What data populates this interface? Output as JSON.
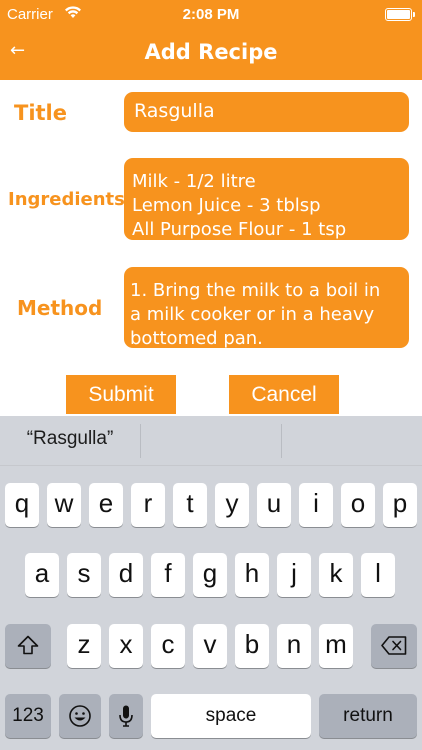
{
  "status_bar": {
    "carrier": "Carrier",
    "time": "2:08 PM"
  },
  "nav": {
    "back_icon": "←",
    "title": "Add Recipe"
  },
  "form": {
    "title_label": "Title",
    "title_value": "Rasgulla",
    "ingredients_label": "Ingredients",
    "ingredients_lines": [
      "Milk - 1/2 litre",
      "Lemon Juice - 3 tblsp",
      "All Purpose Flour - 1 tsp"
    ],
    "method_label": "Method",
    "method_lines": [
      "1. Bring the milk to a boil in",
      "a milk cooker or in a heavy",
      "bottomed pan."
    ]
  },
  "buttons": {
    "submit": "Submit",
    "cancel": "Cancel"
  },
  "keyboard": {
    "suggestions": [
      "“Rasgulla”",
      "",
      ""
    ],
    "row1": [
      "q",
      "w",
      "e",
      "r",
      "t",
      "y",
      "u",
      "i",
      "o",
      "p"
    ],
    "row2": [
      "a",
      "s",
      "d",
      "f",
      "g",
      "h",
      "j",
      "k",
      "l"
    ],
    "row3": [
      "z",
      "x",
      "c",
      "v",
      "b",
      "n",
      "m"
    ],
    "numbers_key": "123",
    "space_key": "space",
    "return_key": "return"
  },
  "colors": {
    "accent": "#F7931E",
    "keyboard_bg": "#D1D4DA",
    "special_key": "#ABB0BA"
  }
}
